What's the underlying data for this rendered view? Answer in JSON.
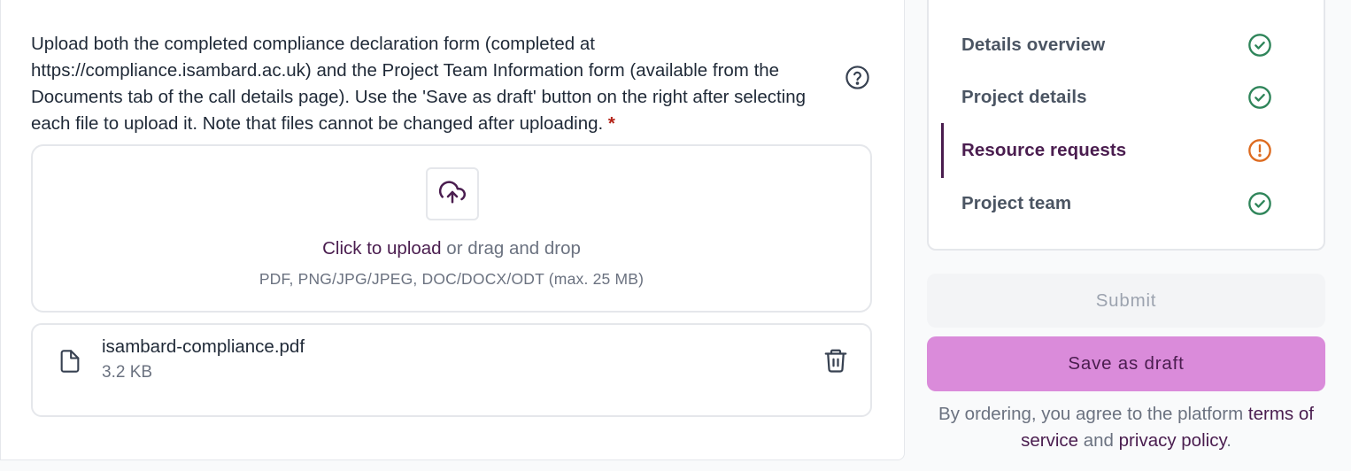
{
  "upload_field": {
    "description": "Upload both the completed compliance declaration form (completed at https://compliance.isambard.ac.uk) and the Project Team Information form (available from the Documents tab of the call details page). Use the 'Save as draft' button on the right after selecting each file to upload it. Note that files cannot be changed after uploading.",
    "required_marker": "*",
    "help_icon": "question-circle-icon"
  },
  "dropzone": {
    "upload_icon": "cloud-upload-icon",
    "link_label": "Click to upload",
    "rest_label": " or drag and drop",
    "hint": "PDF, PNG/JPG/JPEG, DOC/DOCX/ODT (max. 25 MB)"
  },
  "uploaded_file": {
    "icon": "file-icon",
    "name": "isambard-compliance.pdf",
    "size": "3.2 KB",
    "delete_icon": "trash-icon"
  },
  "steps": [
    {
      "label": "Details overview",
      "status": "complete",
      "status_icon": "check-circle-icon"
    },
    {
      "label": "Project details",
      "status": "complete",
      "status_icon": "check-circle-icon"
    },
    {
      "label": "Resource requests",
      "status": "warning",
      "status_icon": "exclamation-circle-icon",
      "active": true
    },
    {
      "label": "Project team",
      "status": "complete",
      "status_icon": "check-circle-icon"
    }
  ],
  "actions": {
    "submit_label": "Submit",
    "submit_disabled": true,
    "draft_label": "Save as draft"
  },
  "terms": {
    "prefix": "By ordering, you agree to the platform ",
    "tos_link": "terms of service",
    "and_text": " and ",
    "privacy_link": "privacy policy",
    "suffix": "."
  },
  "colors": {
    "brand": "#4a1d4f",
    "draft_button": "#da8bda",
    "success": "#2f855a",
    "warning": "#dd6b20",
    "required": "#b42318"
  }
}
